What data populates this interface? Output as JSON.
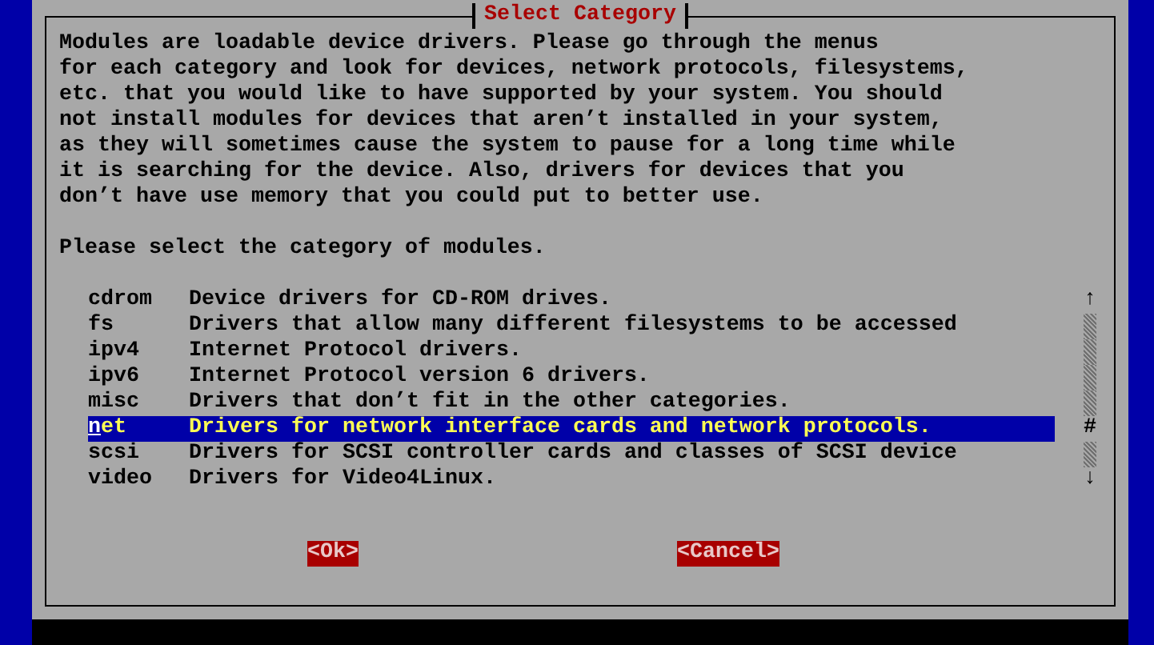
{
  "dialog": {
    "title": "Select Category",
    "message": "Modules are loadable device drivers. Please go through the menus\nfor each category and look for devices, network protocols, filesystems,\netc. that you would like to have supported by your system. You should\nnot install modules for devices that aren’t installed in your system,\nas they will sometimes cause the system to pause for a long time while\nit is searching for the device. Also, drivers for devices that you\ndon’t have use memory that you could put to better use.",
    "prompt": "Please select the category of modules.",
    "items": [
      {
        "name": "cdrom",
        "description": "Device drivers for CD-ROM drives.",
        "selected": false
      },
      {
        "name": "fs",
        "description": "Drivers that allow many different filesystems to be accessed",
        "selected": false
      },
      {
        "name": "ipv4",
        "description": "Internet Protocol drivers.",
        "selected": false
      },
      {
        "name": "ipv6",
        "description": "Internet Protocol version 6 drivers.",
        "selected": false
      },
      {
        "name": "misc",
        "description": "Drivers that don’t fit in the other categories.",
        "selected": false
      },
      {
        "name": "net",
        "description": "Drivers for network interface cards and network protocols.",
        "selected": true
      },
      {
        "name": "scsi",
        "description": "Drivers for SCSI controller cards and classes of SCSI device",
        "selected": false
      },
      {
        "name": "video",
        "description": "Drivers for Video4Linux.",
        "selected": false
      }
    ],
    "scrollbar": {
      "up": "↑",
      "thumb": "#",
      "down": "↓"
    },
    "buttons": [
      "<Ok>",
      "<Cancel>"
    ]
  }
}
